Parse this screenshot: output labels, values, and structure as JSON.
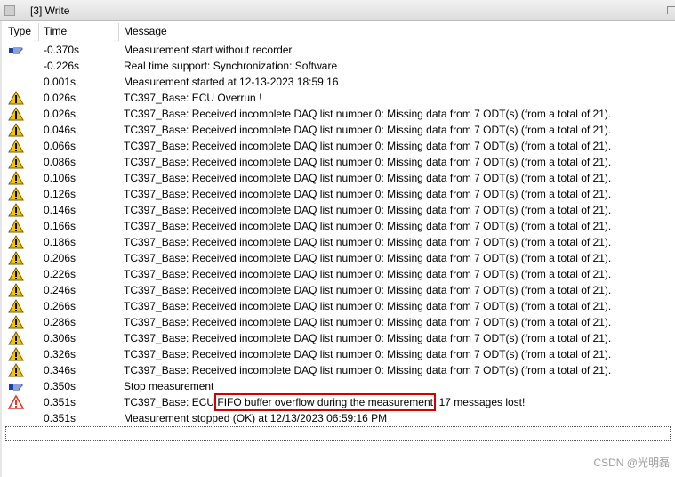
{
  "window": {
    "title": "[3] Write"
  },
  "columns": {
    "type": "Type",
    "time": "Time",
    "message": "Message"
  },
  "entries": [
    {
      "icon": "pointer-hand-icon",
      "time": "-0.370s",
      "message": "Measurement start without recorder"
    },
    {
      "icon": "",
      "time": "-0.226s",
      "message": "Real time support: Synchronization: Software"
    },
    {
      "icon": "",
      "time": "0.001s",
      "message": "Measurement started at  12-13-2023 18:59:16"
    },
    {
      "icon": "warning-icon",
      "time": "0.026s",
      "message": "TC397_Base: ECU Overrun !"
    },
    {
      "icon": "warning-icon",
      "time": "0.026s",
      "message": "TC397_Base: Received incomplete DAQ list number 0: Missing data from 7 ODT(s) (from a total of 21)."
    },
    {
      "icon": "warning-icon",
      "time": "0.046s",
      "message": "TC397_Base: Received incomplete DAQ list number 0: Missing data from 7 ODT(s) (from a total of 21)."
    },
    {
      "icon": "warning-icon",
      "time": "0.066s",
      "message": "TC397_Base: Received incomplete DAQ list number 0: Missing data from 7 ODT(s) (from a total of 21)."
    },
    {
      "icon": "warning-icon",
      "time": "0.086s",
      "message": "TC397_Base: Received incomplete DAQ list number 0: Missing data from 7 ODT(s) (from a total of 21)."
    },
    {
      "icon": "warning-icon",
      "time": "0.106s",
      "message": "TC397_Base: Received incomplete DAQ list number 0: Missing data from 7 ODT(s) (from a total of 21)."
    },
    {
      "icon": "warning-icon",
      "time": "0.126s",
      "message": "TC397_Base: Received incomplete DAQ list number 0: Missing data from 7 ODT(s) (from a total of 21)."
    },
    {
      "icon": "warning-icon",
      "time": "0.146s",
      "message": "TC397_Base: Received incomplete DAQ list number 0: Missing data from 7 ODT(s) (from a total of 21)."
    },
    {
      "icon": "warning-icon",
      "time": "0.166s",
      "message": "TC397_Base: Received incomplete DAQ list number 0: Missing data from 7 ODT(s) (from a total of 21)."
    },
    {
      "icon": "warning-icon",
      "time": "0.186s",
      "message": "TC397_Base: Received incomplete DAQ list number 0: Missing data from 7 ODT(s) (from a total of 21)."
    },
    {
      "icon": "warning-icon",
      "time": "0.206s",
      "message": "TC397_Base: Received incomplete DAQ list number 0: Missing data from 7 ODT(s) (from a total of 21)."
    },
    {
      "icon": "warning-icon",
      "time": "0.226s",
      "message": "TC397_Base: Received incomplete DAQ list number 0: Missing data from 7 ODT(s) (from a total of 21)."
    },
    {
      "icon": "warning-icon",
      "time": "0.246s",
      "message": "TC397_Base: Received incomplete DAQ list number 0: Missing data from 7 ODT(s) (from a total of 21)."
    },
    {
      "icon": "warning-icon",
      "time": "0.266s",
      "message": "TC397_Base: Received incomplete DAQ list number 0: Missing data from 7 ODT(s) (from a total of 21)."
    },
    {
      "icon": "warning-icon",
      "time": "0.286s",
      "message": "TC397_Base: Received incomplete DAQ list number 0: Missing data from 7 ODT(s) (from a total of 21)."
    },
    {
      "icon": "warning-icon",
      "time": "0.306s",
      "message": "TC397_Base: Received incomplete DAQ list number 0: Missing data from 7 ODT(s) (from a total of 21)."
    },
    {
      "icon": "warning-icon",
      "time": "0.326s",
      "message": "TC397_Base: Received incomplete DAQ list number 0: Missing data from 7 ODT(s) (from a total of 21)."
    },
    {
      "icon": "warning-icon",
      "time": "0.346s",
      "message": "TC397_Base: Received incomplete DAQ list number 0: Missing data from 7 ODT(s) (from a total of 21)."
    },
    {
      "icon": "pointer-hand-icon",
      "time": "0.350s",
      "message": "Stop measurement"
    },
    {
      "icon": "error-icon",
      "time": "0.351s",
      "message": "TC397_Base: ECU ",
      "highlight": "FIFO buffer overflow during the measurement",
      "message_tail": ", 17 messages lost!"
    },
    {
      "icon": "",
      "time": "0.351s",
      "message": "Measurement stopped (OK) at  12/13/2023     06:59:16 PM"
    }
  ],
  "watermark": "CSDN @光明磊",
  "colors": {
    "warning_fill": "#f5c400",
    "error_fill": "#e03a2a",
    "highlight_box": "#d40000"
  }
}
